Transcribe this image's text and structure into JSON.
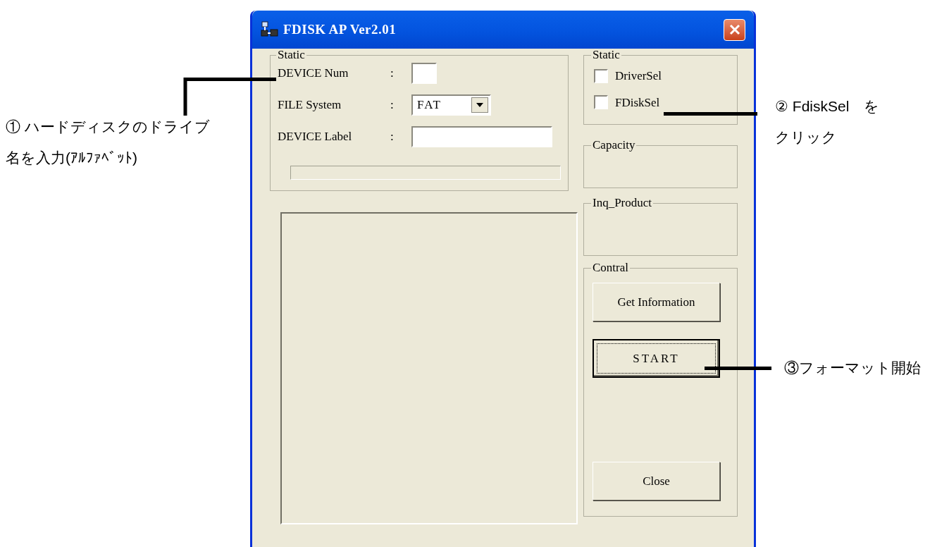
{
  "window": {
    "title": "FDISK AP Ver2.01"
  },
  "settings_group": {
    "title": "Static",
    "fields": [
      {
        "kind": "text",
        "label": "DEVICE Num",
        "colon": ":"
      },
      {
        "kind": "dropdown",
        "label": "FILE System",
        "colon": ":",
        "value": "FAT"
      },
      {
        "kind": "text",
        "label": "DEVICE Label",
        "colon": ":"
      }
    ],
    "progress": {
      "level": 0
    }
  },
  "log_list": {
    "kind": "listbox"
  },
  "options_group": {
    "title": "Static",
    "checkboxes": [
      {
        "label": "DriverSel",
        "checked": false
      },
      {
        "label": "FDiskSel",
        "checked": false
      }
    ]
  },
  "capacity_group": {
    "title": "Capacity"
  },
  "inq_product_group": {
    "title": "Inq_Product"
  },
  "control_group": {
    "title": "Contral",
    "buttons": [
      {
        "label": "Get Information",
        "focused": false
      },
      {
        "label": "START",
        "focused": true
      },
      {
        "label": "Close",
        "focused": false
      }
    ]
  },
  "annotations": [
    {
      "lines": [
        "① ハードディスクのドライブ",
        "名を入力(ｱﾙﾌｧﾍﾞｯﾄ)"
      ]
    },
    {
      "lines": [
        "② FdiskSel　を",
        "クリック"
      ]
    },
    {
      "lines": [
        "③フォーマット開始"
      ]
    }
  ]
}
